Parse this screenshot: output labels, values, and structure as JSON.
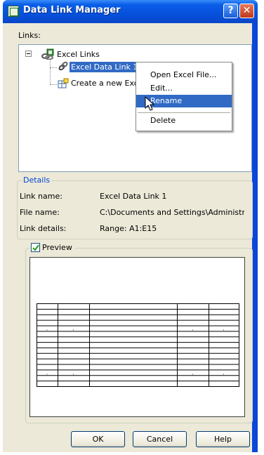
{
  "window": {
    "title": "Data Link Manager",
    "help_glyph": "?",
    "close_glyph": "✕"
  },
  "links_label": "Links:",
  "tree": {
    "root_label": "Excel Links",
    "items": [
      {
        "label": "Excel Data Link 1"
      },
      {
        "label": "Create a new Exc"
      }
    ]
  },
  "context_menu": {
    "items": [
      "Open Excel File...",
      "Edit...",
      "Rename",
      "Delete"
    ],
    "highlighted": "Rename"
  },
  "details": {
    "title": "Details",
    "rows": [
      {
        "key": "Link name:",
        "value": "Excel Data Link 1"
      },
      {
        "key": "File name:",
        "value": "C:\\Documents and Settings\\Administr..."
      },
      {
        "key": "Link details:",
        "value": "Range: A1:E15"
      }
    ]
  },
  "preview": {
    "label": "Preview",
    "checked": true,
    "rows": 15,
    "cols": 5,
    "cell_mark": "."
  },
  "buttons": {
    "ok": "OK",
    "cancel": "Cancel",
    "help": "Help"
  },
  "colors": {
    "title_bar": "#0a5ee8",
    "selection": "#316ac5",
    "dialog_bg": "#ece9d8"
  }
}
